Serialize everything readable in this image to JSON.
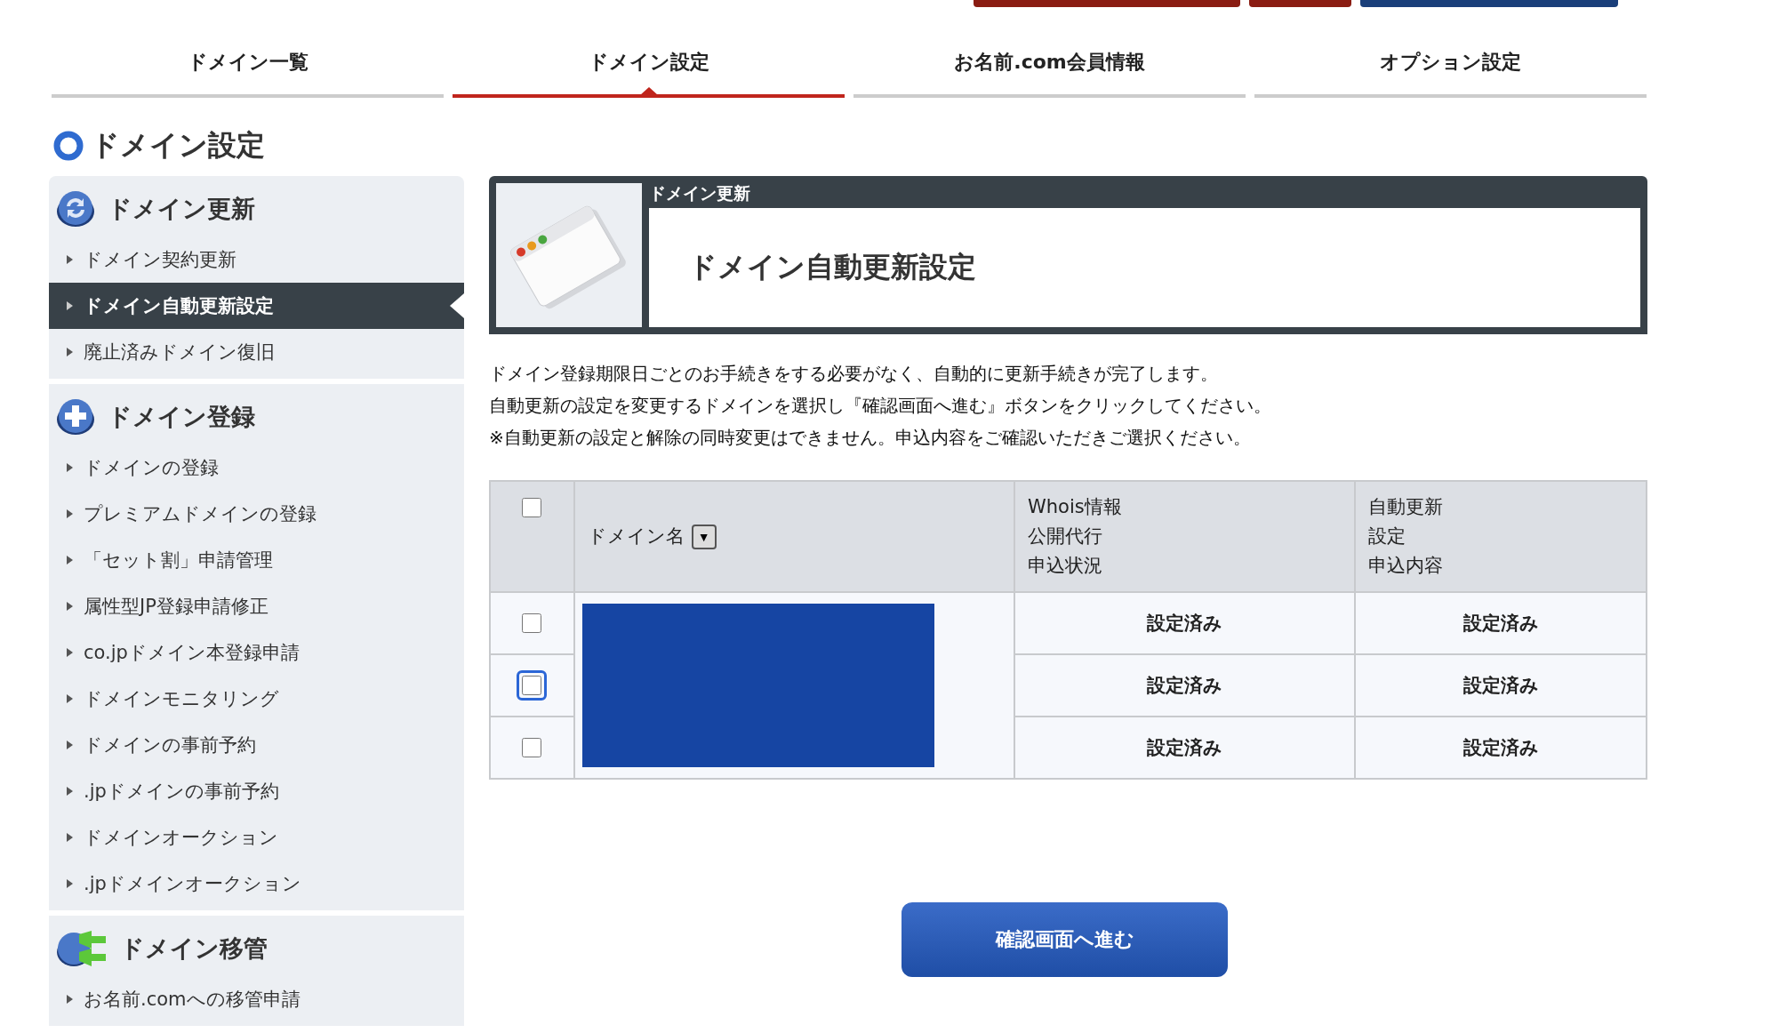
{
  "top_buttons": [
    {
      "color": "#8a1c12"
    },
    {
      "color": "#8a1c12"
    },
    {
      "color": "#1a3f7a"
    }
  ],
  "tabs": [
    {
      "label": "ドメイン一覧",
      "selected": false
    },
    {
      "label": "ドメイン設定",
      "selected": true
    },
    {
      "label": "お名前.com会員情報",
      "selected": false
    },
    {
      "label": "オプション設定",
      "selected": false
    }
  ],
  "page_title": "ドメイン設定",
  "sidebar": {
    "sections": [
      {
        "kind": "renew",
        "title": "ドメイン更新",
        "items": [
          {
            "label": "ドメイン契約更新",
            "selected": false
          },
          {
            "label": "ドメイン自動更新設定",
            "selected": true
          },
          {
            "label": "廃止済みドメイン復旧",
            "selected": false
          }
        ]
      },
      {
        "kind": "register",
        "title": "ドメイン登録",
        "items": [
          {
            "label": "ドメインの登録",
            "selected": false
          },
          {
            "label": "プレミアムドメインの登録",
            "selected": false
          },
          {
            "label": "「セット割」申請管理",
            "selected": false
          },
          {
            "label": "属性型JP登録申請修正",
            "selected": false
          },
          {
            "label": "co.jpドメイン本登録申請",
            "selected": false
          },
          {
            "label": "ドメインモニタリング",
            "selected": false
          },
          {
            "label": "ドメインの事前予約",
            "selected": false
          },
          {
            "label": ".jpドメインの事前予約",
            "selected": false
          },
          {
            "label": "ドメインオークション",
            "selected": false
          },
          {
            "label": ".jpドメインオークション",
            "selected": false
          }
        ]
      },
      {
        "kind": "transfer",
        "title": "ドメイン移管",
        "items": [
          {
            "label": "お名前.comへの移管申請",
            "selected": false
          }
        ]
      }
    ]
  },
  "header_card": {
    "category": "ドメイン更新",
    "title": "ドメイン自動更新設定"
  },
  "description": [
    "ドメイン登録期限日ごとのお手続きをする必要がなく、自動的に更新手続きが完了します。",
    "自動更新の設定を変更するドメインを選択し『確認画面へ進む』ボタンをクリックしてください。",
    "※自動更新の設定と解除の同時変更はできません。申込内容をご確認いただきご選択ください。"
  ],
  "table": {
    "select_all": {
      "checked": false
    },
    "columns": [
      {
        "lines": [
          "ドメイン名"
        ],
        "sort_icon": "▼"
      },
      {
        "lines": [
          "Whois情報",
          "公開代行",
          "申込状況"
        ]
      },
      {
        "lines": [
          "自動更新",
          "設定",
          "申込内容"
        ]
      }
    ],
    "rows": [
      {
        "checked": false,
        "focused": false,
        "whois": "設定済み",
        "auto_renew": "設定済み"
      },
      {
        "checked": false,
        "focused": true,
        "whois": "設定済み",
        "auto_renew": "設定済み"
      },
      {
        "checked": false,
        "focused": false,
        "whois": "設定済み",
        "auto_renew": "設定済み"
      }
    ]
  },
  "confirm_button": "確認画面へ進む"
}
